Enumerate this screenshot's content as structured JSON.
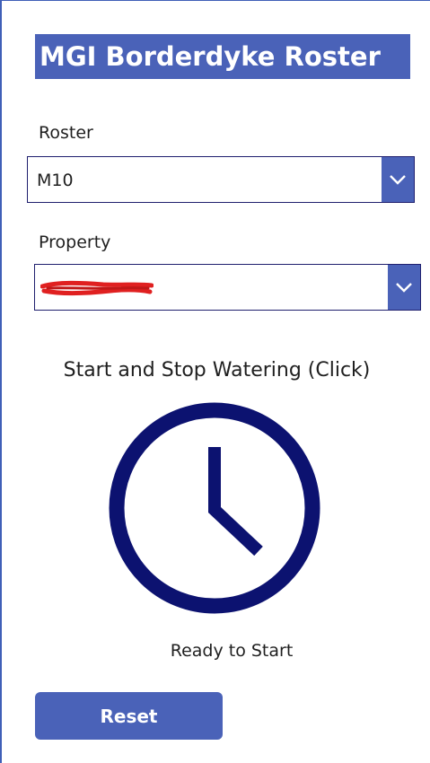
{
  "app": {
    "title": "MGI Borderdyke Roster",
    "accent_color": "#4a62b8",
    "clock_color": "#0c1270"
  },
  "roster": {
    "label": "Roster",
    "selected": "M10",
    "icon": "chevron-down-icon"
  },
  "property": {
    "label": "Property",
    "selected": "",
    "redacted": true,
    "icon": "chevron-down-icon"
  },
  "watering": {
    "prompt": "Start and Stop Watering (Click)",
    "icon": "clock-icon",
    "status": "Ready to Start"
  },
  "actions": {
    "reset_label": "Reset"
  }
}
